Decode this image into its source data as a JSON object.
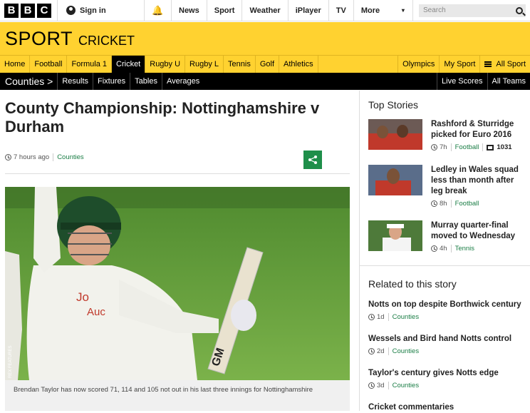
{
  "topbar": {
    "logo_letters": [
      "B",
      "B",
      "C"
    ],
    "signin": "Sign in",
    "nav": [
      "News",
      "Sport",
      "Weather",
      "iPlayer",
      "TV"
    ],
    "more": "More",
    "search_placeholder": "Search"
  },
  "sport_header": {
    "title": "SPORT",
    "section": "CRICKET"
  },
  "sport_nav": {
    "left": [
      "Home",
      "Football",
      "Formula 1",
      "Cricket",
      "Rugby U",
      "Rugby L",
      "Tennis",
      "Golf",
      "Athletics"
    ],
    "active": "Cricket",
    "right": [
      "Olympics",
      "My Sport"
    ],
    "all_sport": "All Sport"
  },
  "sub_nav": {
    "current": "Counties >",
    "items": [
      "Results",
      "Fixtures",
      "Tables",
      "Averages"
    ],
    "right": [
      "Live Scores",
      "All Teams"
    ]
  },
  "article": {
    "headline": "County Championship: Nottinghamshire v Durham",
    "time": "7 hours ago",
    "tag": "Counties",
    "image_credit": "REX FEATURES",
    "caption": "Brendan Taylor has now scored 71, 114 and 105 not out in his last three innings for Nottinghamshire"
  },
  "top_stories": {
    "heading": "Top Stories",
    "items": [
      {
        "title": "Rashford & Sturridge picked for Euro 2016",
        "time": "7h",
        "tag": "Football",
        "comments": "1031"
      },
      {
        "title": "Ledley in Wales squad less than month after leg break",
        "time": "8h",
        "tag": "Football"
      },
      {
        "title": "Murray quarter-final moved to Wednesday",
        "time": "4h",
        "tag": "Tennis"
      }
    ]
  },
  "related": {
    "heading": "Related to this story",
    "items": [
      {
        "title": "Notts on top despite Borthwick century",
        "time": "1d",
        "tag": "Counties"
      },
      {
        "title": "Wessels and Bird hand Notts control",
        "time": "2d",
        "tag": "Counties"
      },
      {
        "title": "Taylor's century gives Notts edge",
        "time": "3d",
        "tag": "Counties"
      },
      {
        "title": "Cricket commentaries"
      }
    ]
  },
  "colors": {
    "sport_yellow": "#ffd230",
    "tag_green": "#1b7e46",
    "share_green": "#1f8f4a"
  }
}
